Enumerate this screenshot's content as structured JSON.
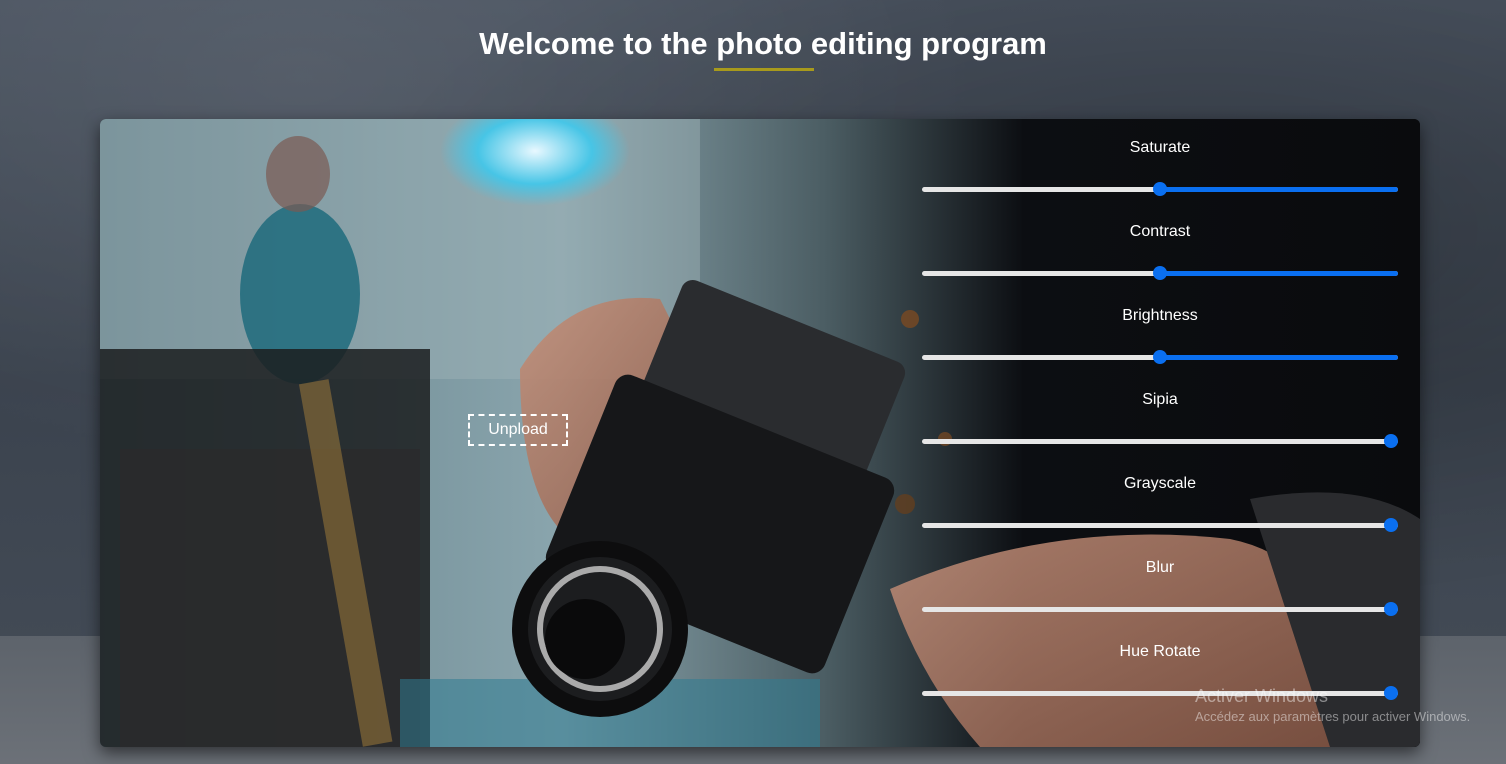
{
  "page": {
    "title": "Welcome to the photo editing program"
  },
  "editor": {
    "upload_label": "Unpload",
    "accent_color": "#0a6ff0",
    "track_color": "#e6e6e6",
    "controls": [
      {
        "label": "Saturate",
        "value": 0.5
      },
      {
        "label": "Contrast",
        "value": 0.5
      },
      {
        "label": "Brightness",
        "value": 0.5
      },
      {
        "label": "Sipia",
        "value": 1.0
      },
      {
        "label": "Grayscale",
        "value": 1.0
      },
      {
        "label": "Blur",
        "value": 1.0
      },
      {
        "label": "Hue Rotate",
        "value": 1.0
      }
    ]
  },
  "os_watermark": {
    "title": "Activer Windows",
    "subtitle": "Accédez aux paramètres pour activer Windows."
  }
}
